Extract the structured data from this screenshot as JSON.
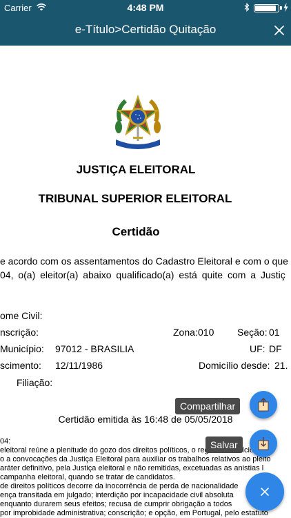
{
  "status_bar": {
    "carrier": "Carrier",
    "time": "4:48 PM",
    "wifi_icon": "wifi-icon",
    "battery_icon": "battery-icon",
    "battery_level": 0.9
  },
  "nav": {
    "title": "e-Título>Certidão Quitação",
    "close_icon": "close-icon"
  },
  "document": {
    "emblem_icon": "brazil-coat-of-arms-icon",
    "heading_1": "JUSTIÇA ELEITORAL",
    "heading_2": "TRIBUNAL SUPERIOR ELEITORAL",
    "heading_3": "Certidão",
    "paragraph_line_1": "e acordo com os assentamentos do Cadastro Eleitoral e com o que",
    "paragraph_line_2": "04, o(a) eleitor(a) abaixo qualificado(a) está quite com a Justiç",
    "fields": {
      "nome_label": "ome Civil:",
      "inscricao_label": "nscrição:",
      "zona_label": "Zona:",
      "zona_value": "010",
      "secao_label": "Seção:",
      "secao_value": "01",
      "municipio_label": "Município:",
      "municipio_value": "97012 - BRASILIA",
      "uf_label": "UF:",
      "uf_value": "DF",
      "nascimento_label": "scimento:",
      "nascimento_value": "12/11/1986",
      "domicilio_label": "Domicílio desde:",
      "domicilio_value": "21.",
      "filiacao_label": "Filiação:"
    },
    "emitted": "Certidão emitida às 16:48 de 05/05/2018",
    "note_heading": "04:",
    "note_lines": [
      "eleitoral reúne a plenitude do gozo dos direitos políticos, o regular exercício do v",
      "o a convocações da Justiça Eleitoral para auxiliar os trabalhos relativos ao pleito",
      "aráter definitivo, pela Justiça eleitoral e não remitidas, excetuadas as anistias l",
      "campanha eleitoral, quando se tratar de candidatos.",
      "de direitos políticos decorre da inocorrência de perda de nacionalidade",
      "ença transitada em julgado; interdição por incapacidade civil absoluta",
      "enquanto durarem seus efeitos; recusa de cumprir obrigação a todos",
      "por improbidade administrativa; conscrição; e opção, em Portugal, pelo estatuto"
    ]
  },
  "actions": {
    "share_label": "Compartilhar",
    "save_label": "Salvar",
    "share_icon": "share-icon",
    "save_icon": "download-icon",
    "main_icon": "close-icon",
    "accent_color": "#2f86e6"
  },
  "colors": {
    "header_bg": "#1b566f",
    "fab_label_bg": "#4a4a4a"
  }
}
